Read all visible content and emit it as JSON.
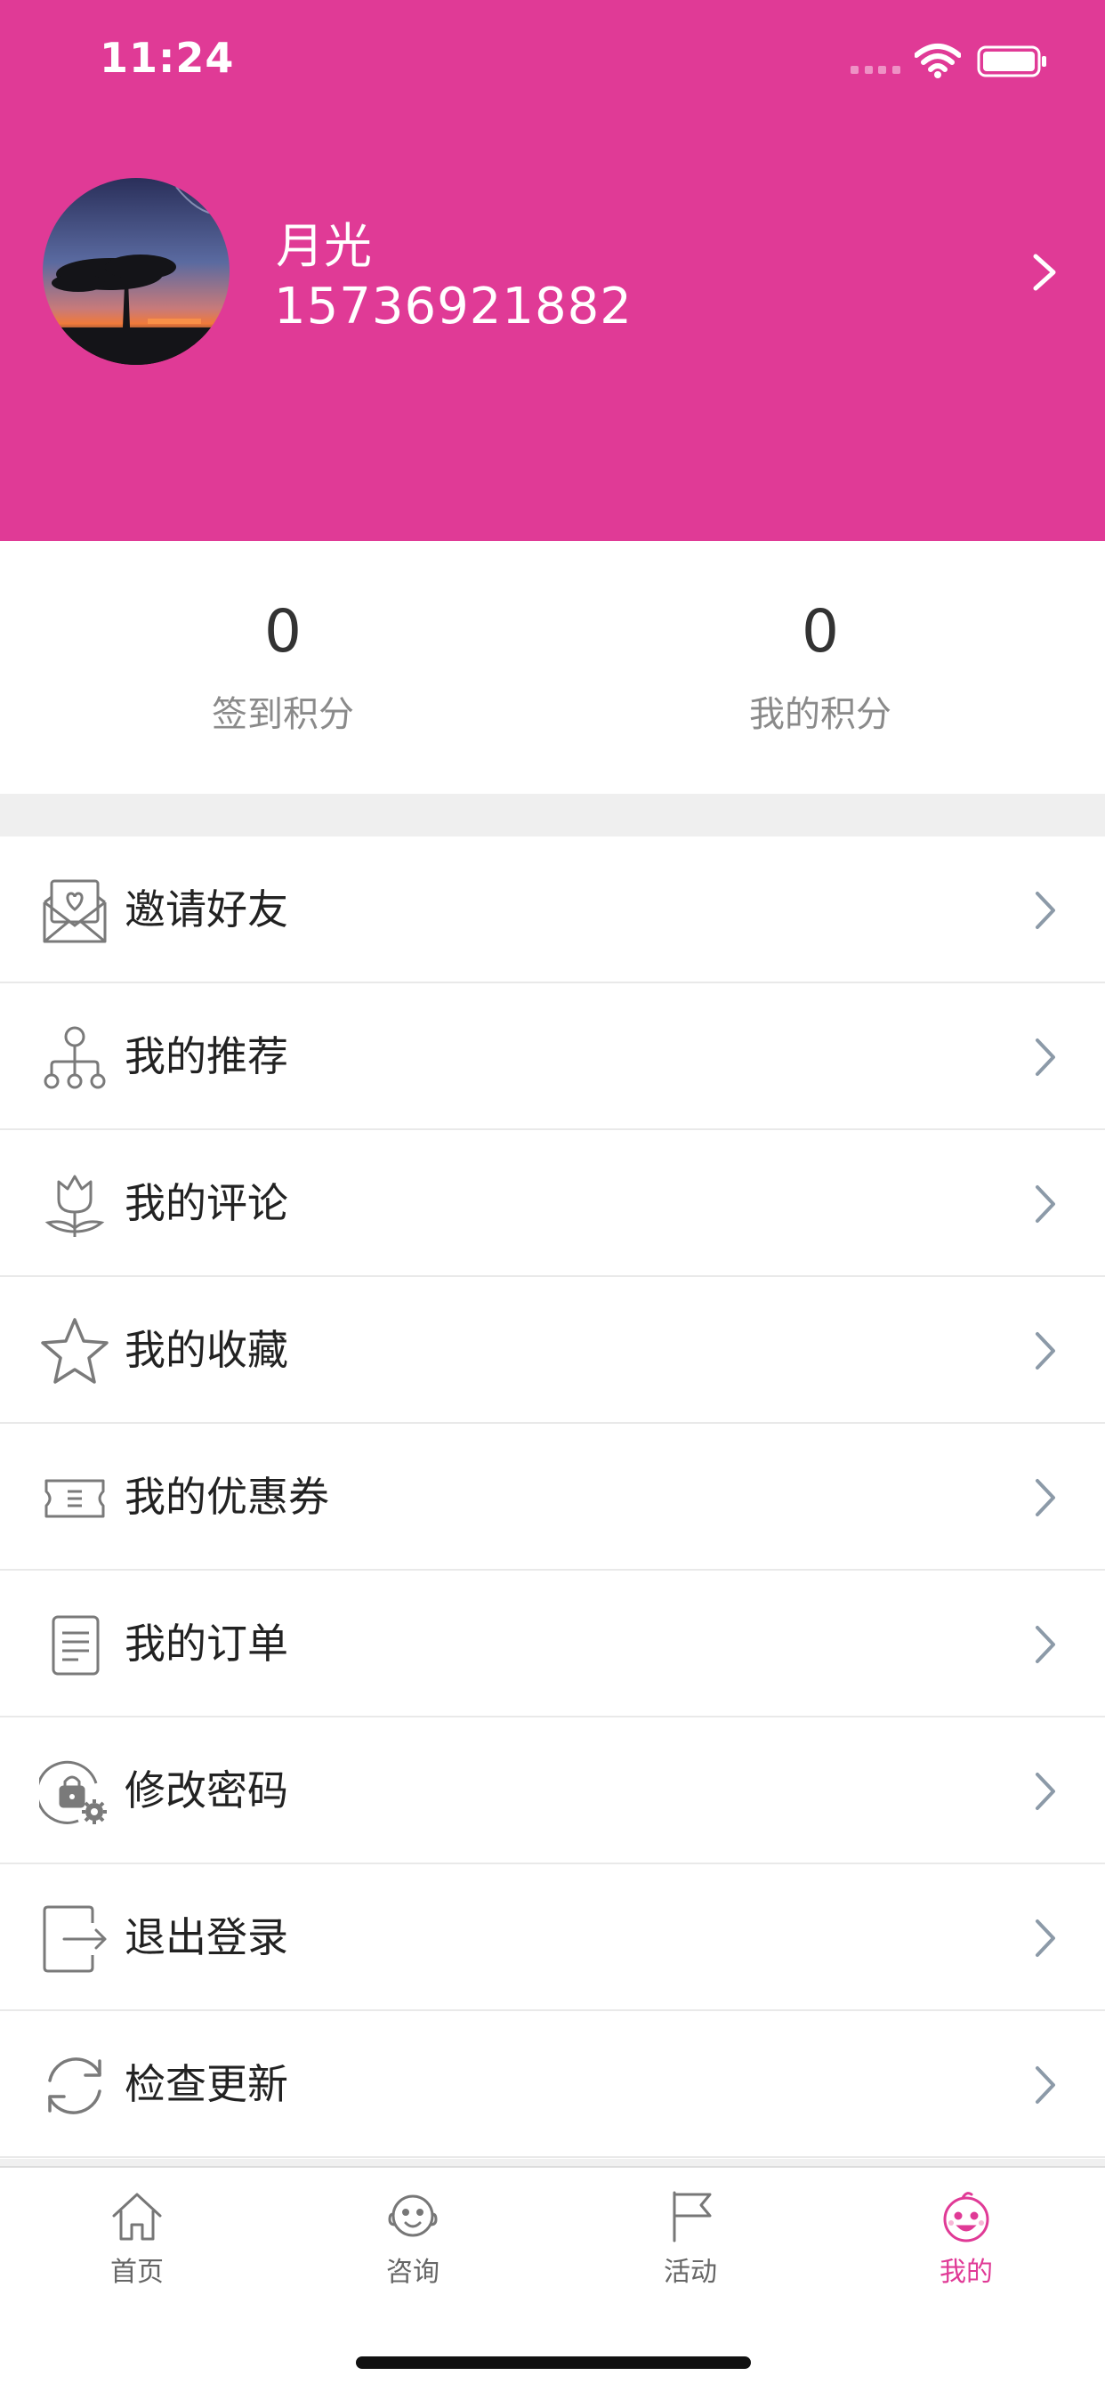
{
  "status_bar": {
    "time": "11:24"
  },
  "profile": {
    "name": "月光",
    "phone": "15736921882"
  },
  "stats": [
    {
      "value": "0",
      "label": "签到积分"
    },
    {
      "value": "0",
      "label": "我的积分"
    }
  ],
  "menu": [
    {
      "label": "邀请好友",
      "icon": "invite-envelope-icon"
    },
    {
      "label": "我的推荐",
      "icon": "recommend-tree-icon"
    },
    {
      "label": "我的评论",
      "icon": "comment-flower-icon"
    },
    {
      "label": "我的收藏",
      "icon": "star-icon"
    },
    {
      "label": "我的优惠券",
      "icon": "coupon-icon"
    },
    {
      "label": "我的订单",
      "icon": "order-document-icon"
    },
    {
      "label": "修改密码",
      "icon": "lock-settings-icon"
    },
    {
      "label": "退出登录",
      "icon": "logout-icon"
    },
    {
      "label": "检查更新",
      "icon": "refresh-icon"
    }
  ],
  "tabbar": [
    {
      "label": "首页",
      "icon": "home-icon",
      "active": false
    },
    {
      "label": "咨询",
      "icon": "consult-face-icon",
      "active": false
    },
    {
      "label": "活动",
      "icon": "flag-icon",
      "active": false
    },
    {
      "label": "我的",
      "icon": "baby-face-icon",
      "active": true
    }
  ],
  "colors": {
    "brand": "#e03a96",
    "text": "#222222",
    "muted": "#8a8a8a",
    "arrow": "#8c9aa8"
  }
}
